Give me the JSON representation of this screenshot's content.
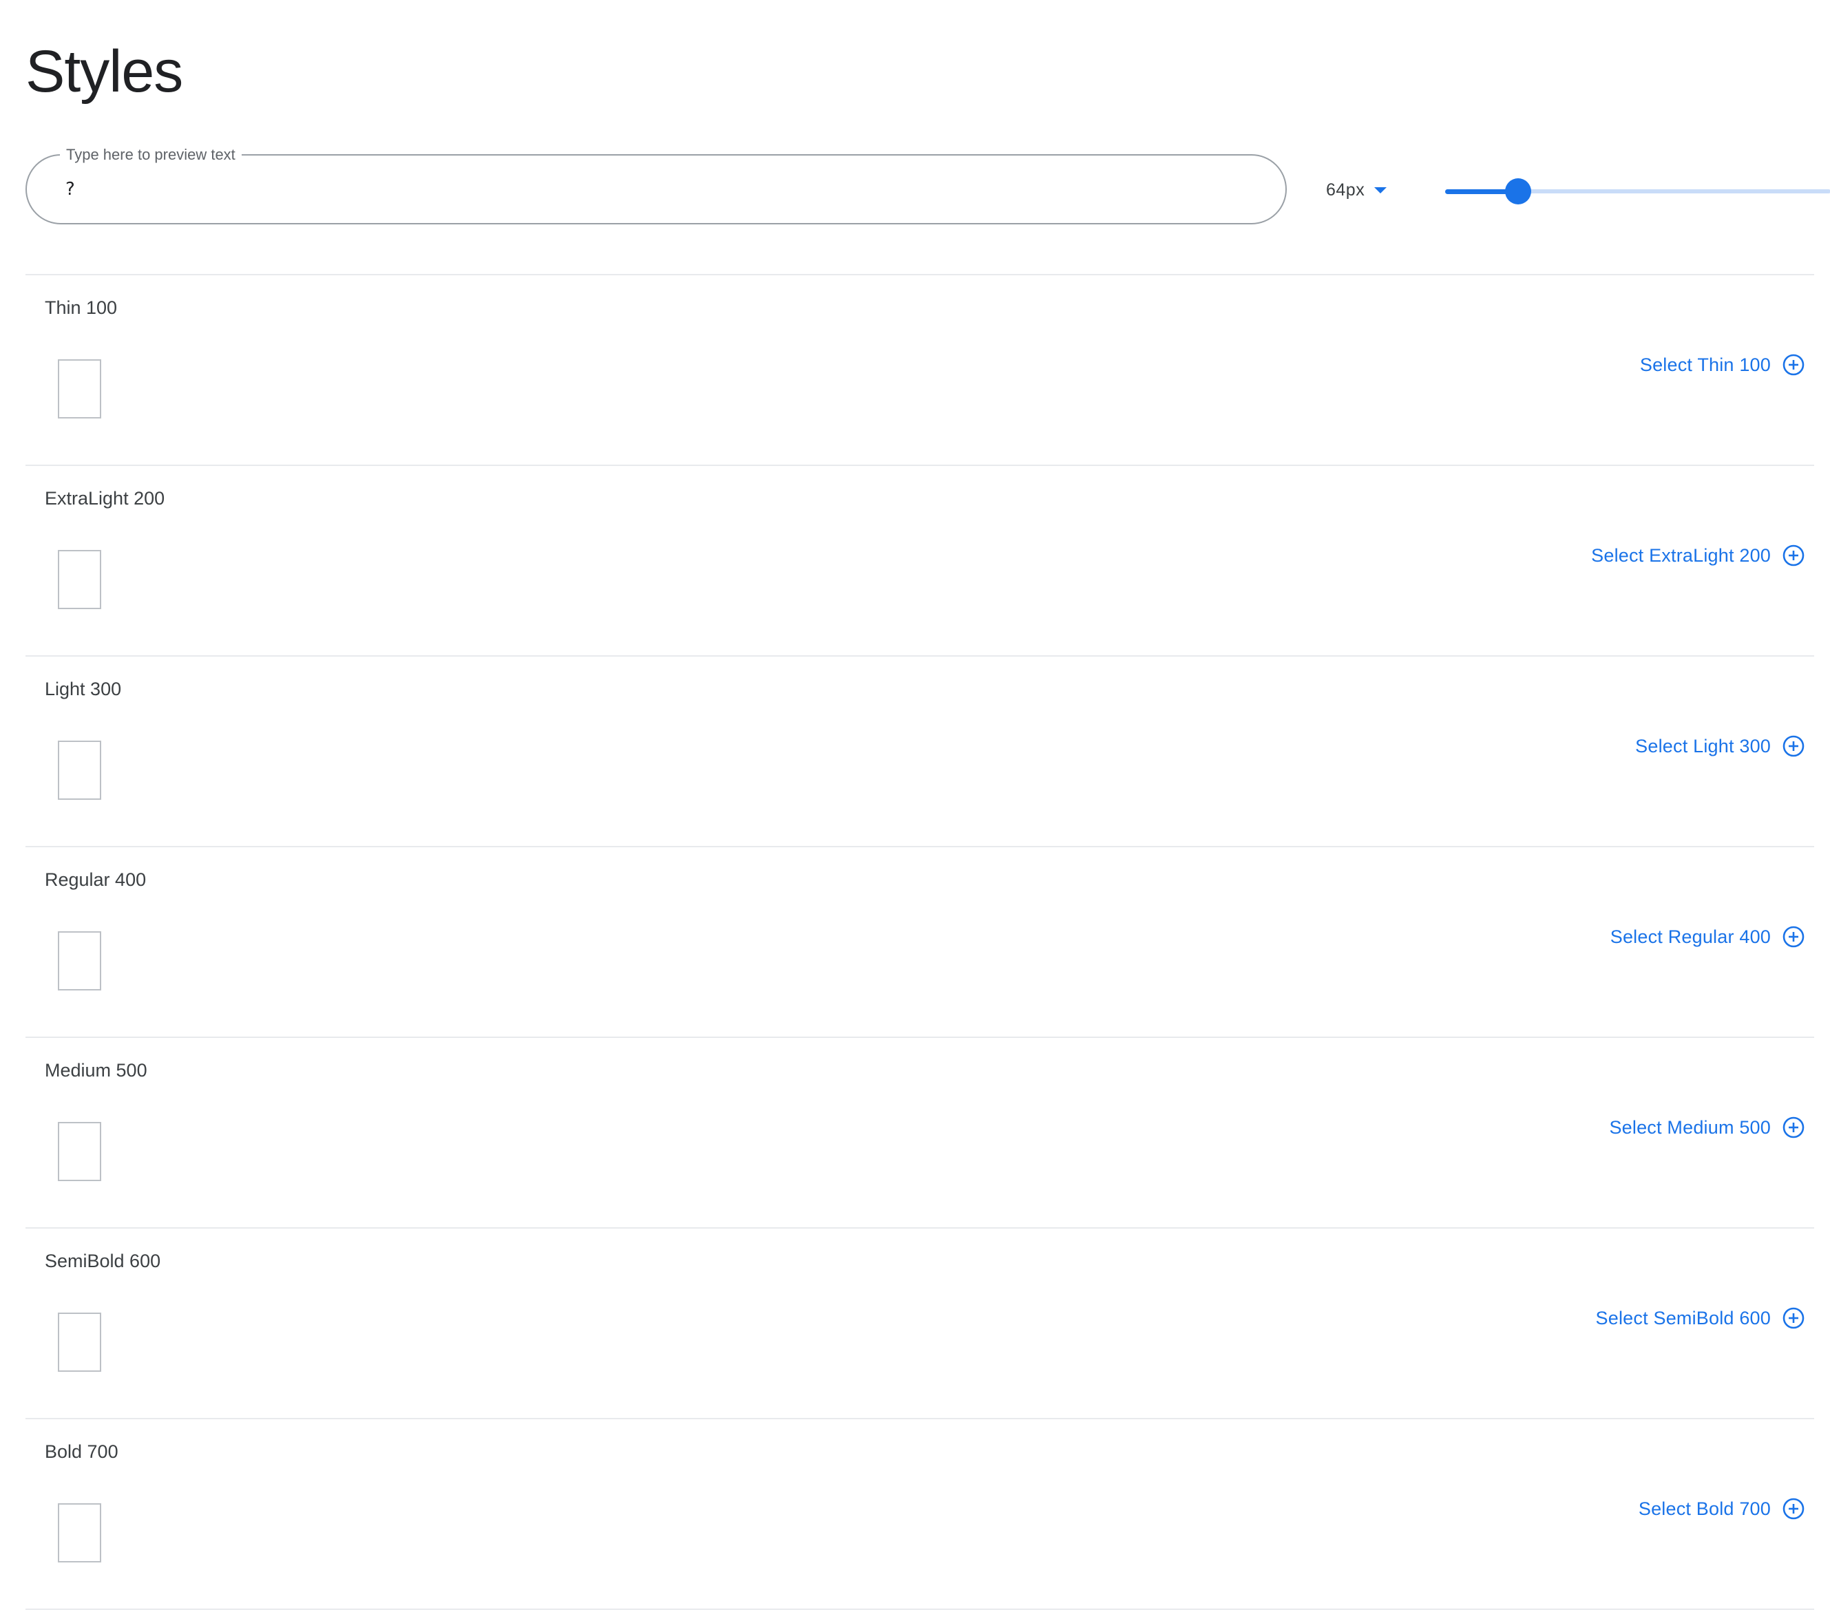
{
  "page": {
    "title": "Styles"
  },
  "preview": {
    "label": "Type here to preview text",
    "value": "?"
  },
  "size": {
    "value": "64px",
    "icon": "caret-down-icon",
    "slider_fraction": 0.19
  },
  "colors": {
    "accent": "#1a73e8",
    "slider_track": "#c9dcf8",
    "divider": "#e8eaed"
  },
  "styles": [
    {
      "name": "Thin 100",
      "action": "Select Thin 100",
      "icon": "add-circle-icon"
    },
    {
      "name": "ExtraLight 200",
      "action": "Select ExtraLight 200",
      "icon": "add-circle-icon"
    },
    {
      "name": "Light 300",
      "action": "Select Light 300",
      "icon": "add-circle-icon"
    },
    {
      "name": "Regular 400",
      "action": "Select Regular 400",
      "icon": "add-circle-icon"
    },
    {
      "name": "Medium 500",
      "action": "Select Medium 500",
      "icon": "add-circle-icon"
    },
    {
      "name": "SemiBold 600",
      "action": "Select SemiBold 600",
      "icon": "add-circle-icon"
    },
    {
      "name": "Bold 700",
      "action": "Select Bold 700",
      "icon": "add-circle-icon"
    }
  ]
}
